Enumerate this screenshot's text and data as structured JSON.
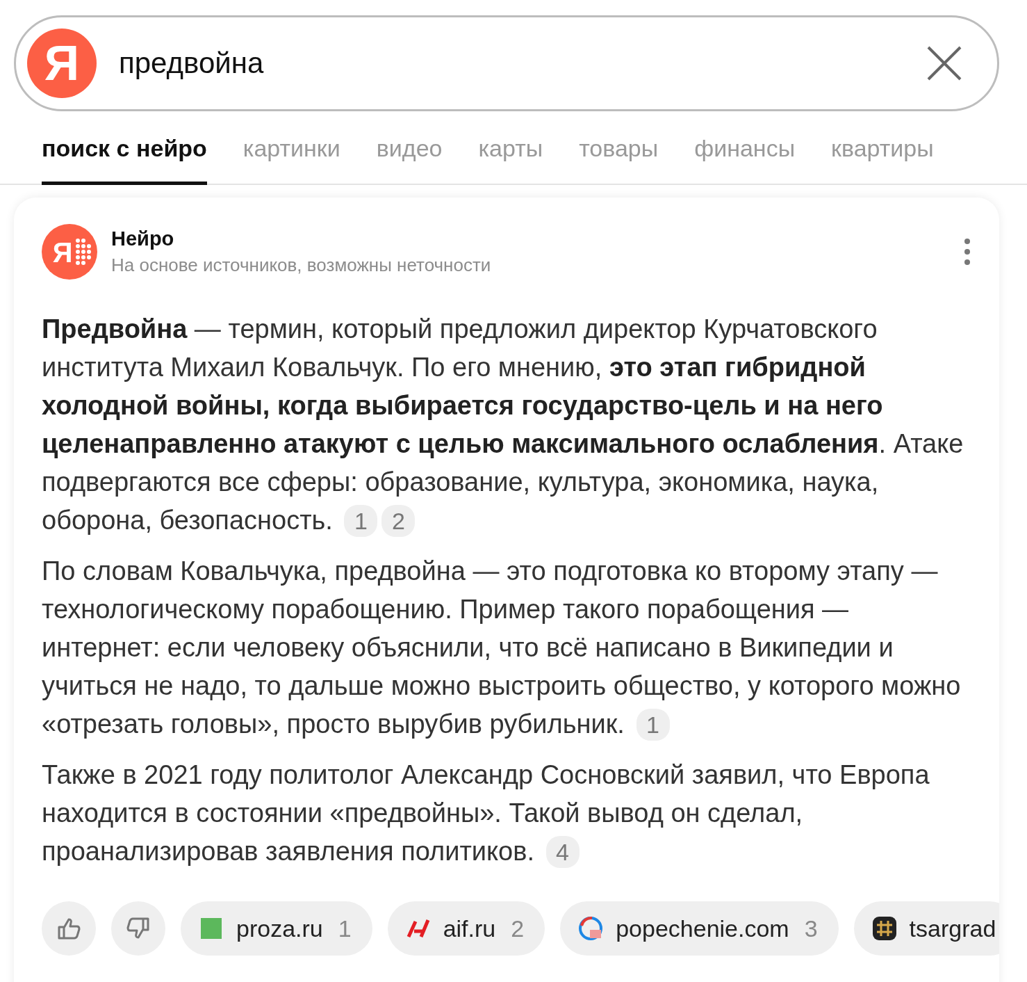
{
  "search": {
    "logo_letter": "Я",
    "query": "предвойна"
  },
  "tabs": [
    {
      "label": "поиск с нейро",
      "selected": true
    },
    {
      "label": "картинки",
      "selected": false
    },
    {
      "label": "видео",
      "selected": false
    },
    {
      "label": "карты",
      "selected": false
    },
    {
      "label": "товары",
      "selected": false
    },
    {
      "label": "финансы",
      "selected": false
    },
    {
      "label": "квартиры",
      "selected": false
    }
  ],
  "answer": {
    "icon_letter": "Я",
    "title": "Нейро",
    "subtitle": "На основе источников, возможны неточности",
    "paragraphs": [
      {
        "text": "**Предвойна** — термин, который предложил директор Курчатовского института Михаил Ковальчук. По его мнению, **это этап гибридной холодной войны, когда выбирается государство-цель и на него целенаправленно атакуют с целью максимального ослабления**. Атаке подвергаются все сферы: образование, культура, экономика, наука, оборона, безопасность.",
        "citations": [
          "1",
          "2"
        ]
      },
      {
        "text": "По словам Ковальчука, предвойна — это подготовка ко второму этапу — технологическому порабощению. Пример такого порабощения — интернет: если человеку объяснили, что всё написано в Википедии и учиться не надо, то дальше можно выстроить общество, у которого можно «отрезать головы», просто вырубив рубильник.",
        "citations": [
          "1"
        ]
      },
      {
        "text": "Также в 2021 году политолог Александр Сосновский заявил, что Европа находится в состоянии «предвойны». Такой вывод он сделал, проанализировав заявления политиков.",
        "citations": [
          "4"
        ]
      }
    ],
    "sources": [
      {
        "kind": "square",
        "name": "proza.ru",
        "number": "1"
      },
      {
        "kind": "mark",
        "name": "aif.ru",
        "number": "2"
      },
      {
        "kind": "globe",
        "name": "popechenie.com",
        "number": "3"
      },
      {
        "kind": "grid",
        "name": "tsargrad"
      }
    ]
  }
}
